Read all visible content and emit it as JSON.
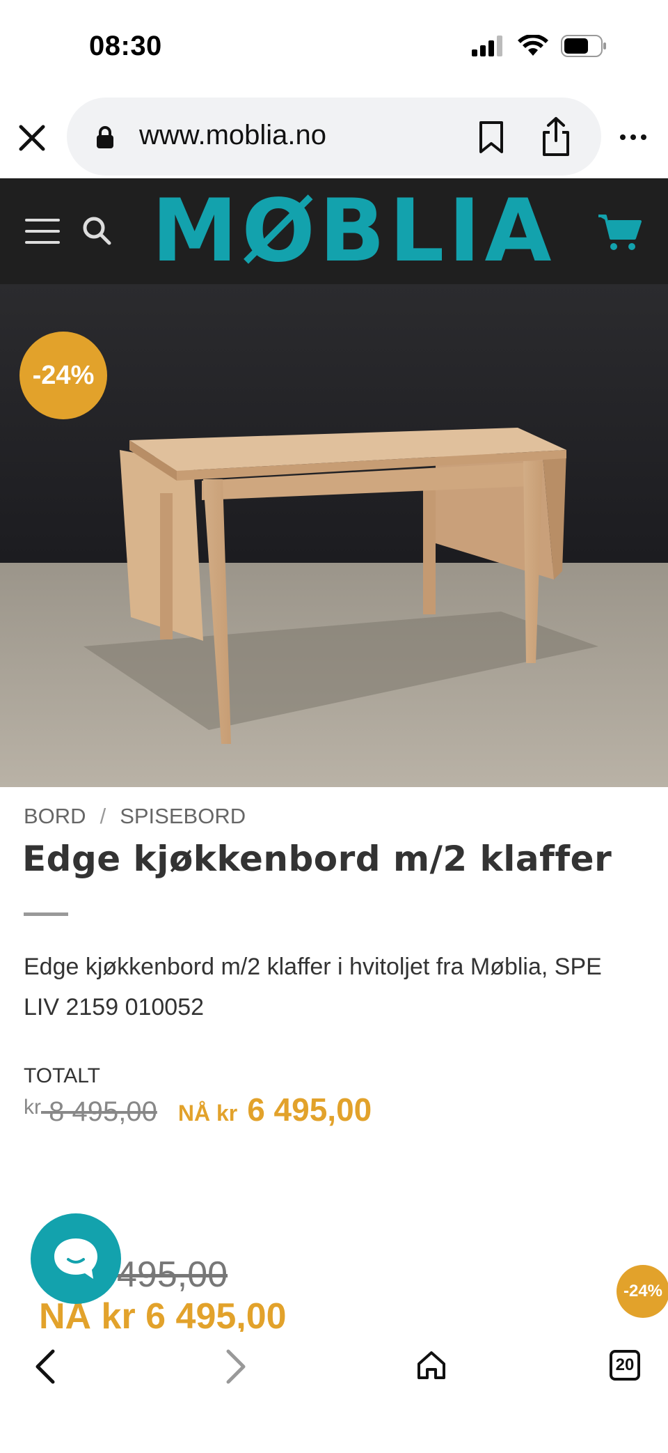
{
  "status": {
    "time": "08:30"
  },
  "browser": {
    "url": "www.moblia.no",
    "tab_count": "20"
  },
  "site": {
    "logo": "MØBLIA",
    "brand_color": "#13a2ad",
    "accent_color": "#e2a22b"
  },
  "product": {
    "discount": "-24%",
    "breadcrumb": [
      "BORD",
      "SPISEBORD"
    ],
    "breadcrumb_sep": "/",
    "title": "Edge kjøkkenbord m/2 klaffer",
    "description": "Edge kjøkkenbord m/2 klaffer i hvitoljet fra Møblia, SPE LIV 2159 010052",
    "total_label": "TOTALT",
    "old_currency": "kr",
    "old_price": " 8 495,00",
    "now_label": "NÅ kr",
    "now_price": "6 495,00"
  },
  "sticky": {
    "old_price": "495,00",
    "now_price": "NÅ kr 6 495,00",
    "discount": "-24%"
  },
  "icons": {
    "close": "close-icon",
    "lock": "lock-icon",
    "bookmark": "bookmark-icon",
    "share": "share-icon",
    "more": "more-icon",
    "menu": "hamburger-menu-icon",
    "search": "search-icon",
    "cart": "cart-icon",
    "chat": "chat-icon",
    "back": "chevron-left-icon",
    "forward": "chevron-right-icon",
    "home": "home-icon"
  }
}
